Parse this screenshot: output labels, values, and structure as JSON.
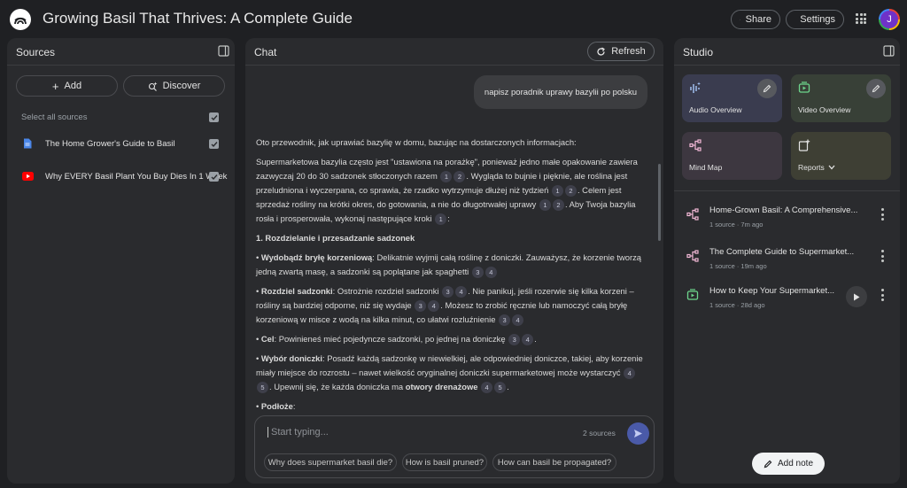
{
  "app": {
    "title": "Growing Basil That Thrives: A Complete Guide",
    "share_label": "Share",
    "settings_label": "Settings",
    "avatar_initial": "J"
  },
  "sources": {
    "title": "Sources",
    "add_label": "Add",
    "discover_label": "Discover",
    "select_all_label": "Select all sources",
    "items": [
      {
        "label": "The Home Grower's Guide to Basil",
        "type": "document",
        "checked": true
      },
      {
        "label": "Why EVERY Basil Plant You Buy Dies In 1 Week",
        "type": "youtube",
        "checked": true
      }
    ]
  },
  "chat": {
    "title": "Chat",
    "refresh_label": "Refresh",
    "user_message": "napisz poradnik uprawy bazylii po polsku",
    "input_placeholder": "Start typing...",
    "sources_count": "2 sources",
    "suggestions": [
      "Why does supermarket basil die?",
      "How is basil pruned?",
      "How can basil be propagated?"
    ],
    "response": {
      "intro": "Oto przewodnik, jak uprawiać bazylię w domu, bazując na dostarczonych informacjach:",
      "p1a": "Supermarketowa bazylia często jest \"ustawiona na porażkę\", ponieważ jedno małe opakowanie zawiera zazwyczaj 20 do 30 sadzonek stłoczonych razem",
      "p1b": ". Wygląda to bujnie i pięknie, ale roślina jest przeludniona i wyczerpana, co sprawia, że rzadko wytrzymuje dłużej niż tydzień",
      "p1c": ". Celem jest sprzedaż rośliny na krótki okres, do gotowania, a nie do długotrwałej uprawy",
      "p1d": ". Aby Twoja bazylia rosła i prosperowała, wykonaj następujące kroki",
      "p1e": ":",
      "heading1": "1. Rozdzielanie i przesadzanie sadzonek",
      "b1_bold": "Wydobądź bryłę korzeniową",
      "b1_text": ": Delikatnie wyjmij całą roślinę z doniczki. Zauważysz, że korzenie tworzą jedną zwartą masę, a sadzonki są poplątane jak spaghetti",
      "b2_bold": "Rozdziel sadzonki",
      "b2a": ": Ostrożnie rozdziel sadzonki",
      "b2b": ". Nie panikuj, jeśli rozerwie się kilka korzeni – rośliny są bardziej odporne, niż się wydaje",
      "b2c": ". Możesz to zrobić ręcznie lub namoczyć całą bryłę korzeniową w misce z wodą na kilka minut, co ułatwi rozluźnienie",
      "b3_bold": "Cel",
      "b3_text": ": Powinieneś mieć pojedyncze sadzonki, po jednej na doniczkę",
      "b4_bold": "Wybór doniczki",
      "b4a": ": Posadź każdą sadzonkę w niewielkiej, ale odpowiedniej doniczce, takiej, aby korzenie miały miejsce do rozrostu – nawet wielkość oryginalnej doniczki supermarketowej może wystarczyć",
      "b4b": ". Upewnij się, że każda doniczka ma",
      "b4_bold2": "otwory drenażowe",
      "b5_bold": "Podłoże",
      "b5_text": ":",
      "cites": {
        "c1": "1",
        "c2": "2",
        "c3": "3",
        "c4": "4",
        "c5": "5"
      }
    }
  },
  "studio": {
    "title": "Studio",
    "cards": [
      {
        "label": "Audio Overview",
        "icon": "audio-waveform-icon",
        "color": "#3a3c4f"
      },
      {
        "label": "Video Overview",
        "icon": "video-icon",
        "color": "#384037"
      },
      {
        "label": "Mind Map",
        "icon": "mind-map-icon",
        "color": "#3d3740"
      },
      {
        "label": "Reports",
        "icon": "reports-icon",
        "color": "#3e3f34"
      }
    ],
    "notes": [
      {
        "title": "Home-Grown Basil: A Comprehensive...",
        "sub": "1 source · 7m ago",
        "icon": "mind-map-icon"
      },
      {
        "title": "The Complete Guide to Supermarket...",
        "sub": "1 source · 19m ago",
        "icon": "mind-map-icon"
      },
      {
        "title": "How to Keep Your Supermarket...",
        "sub": "1 source · 28d ago",
        "icon": "video-icon"
      }
    ],
    "add_note_label": "Add note"
  },
  "colors": {
    "accent": "#a8c7fa",
    "mind_map": "#f2b8d6",
    "video": "#6dd58c"
  }
}
